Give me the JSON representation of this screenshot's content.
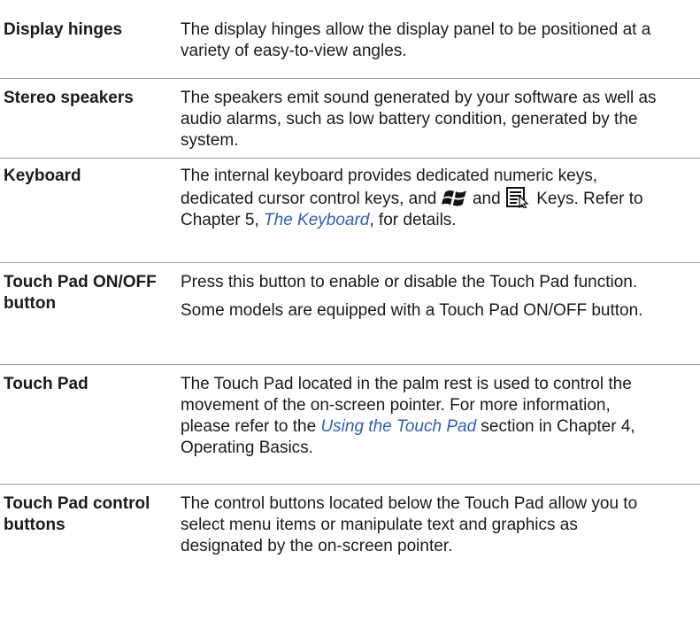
{
  "rows": [
    {
      "term": "Display hinges",
      "desc": "The display hinges allow the display panel to be positioned at a variety of easy-to-view angles."
    },
    {
      "term": "Stereo speakers",
      "desc": "The speakers emit sound generated by your software as well as audio alarms, such as low battery condition, generated by the system."
    },
    {
      "term": "Keyboard",
      "desc_part1": "The internal keyboard provides dedicated numeric keys, dedicated cursor control keys, and",
      "desc_and": "and",
      "desc_part2": "Keys. Refer to Chapter 5,",
      "link": "The Keyboard",
      "desc_part3": ", for details."
    },
    {
      "term": "Touch Pad ON/OFF button",
      "desc": "Press this button to enable or disable the Touch Pad function.",
      "desc2": "Some models are equipped with a Touch Pad ON/OFF button."
    },
    {
      "term": "Touch Pad",
      "desc_part1": "The Touch Pad located in the palm rest is used to control the movement of the on-screen pointer. For more information, please refer to the",
      "link": "Using the Touch Pad",
      "desc_part2": "section in Chapter 4, Operating Basics."
    },
    {
      "term": "Touch Pad control buttons",
      "desc": "The control buttons located below the Touch Pad allow you to select menu items or manipulate text and graphics as designated by the on-screen pointer."
    }
  ],
  "icons": {
    "windows_key": "windows-logo-icon",
    "application_key": "application-menu-icon"
  },
  "colors": {
    "link": "#2f5fb3",
    "rule": "#9a9a9a"
  }
}
